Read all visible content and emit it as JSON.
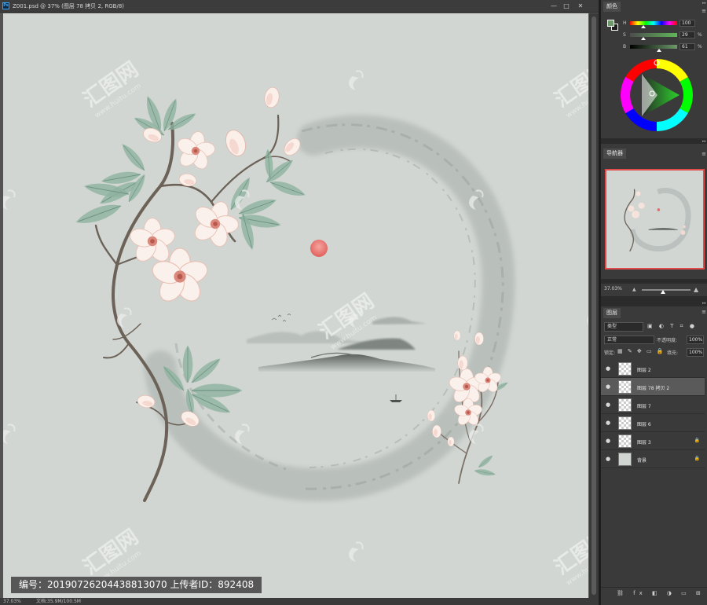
{
  "document": {
    "title": "Z001.psd @ 37% (图层 78 拷贝 2, RGB/8)",
    "zoom": "37.03%",
    "doc_size": "文档:35.9M/100.5M",
    "watermark_brand": "汇图网",
    "watermark_url": "www.huitu.com",
    "banner_text": "编号：20190726204438813070 上传者ID：892408"
  },
  "window_controls": {
    "minimize": "—",
    "restore": "□",
    "close": "✕"
  },
  "color_panel": {
    "tab": "颜色",
    "h_label": "H",
    "h_value": "100",
    "h_level": 0.28,
    "s_label": "S",
    "s_value": "29",
    "s_level": 0.29,
    "b_label": "B",
    "b_value": "61",
    "b_level": 0.61,
    "percent": "%",
    "foreground_color": "#6e9a6b",
    "background_color": "#1b1b1b"
  },
  "navigator_panel": {
    "tab": "导航器",
    "zoom_value": "37.03%",
    "frame_color": "#e34c4c"
  },
  "layers_panel": {
    "tab": "图层",
    "filter_kind": "类型",
    "blend_mode": "正常",
    "opacity_label": "不透明度:",
    "opacity_value": "100%",
    "lock_label": "锁定:",
    "fill_label": "填充:",
    "fill_value": "100%",
    "layers": [
      {
        "name": "图层 2",
        "thumb": "transparent",
        "locked": false,
        "selected": false
      },
      {
        "name": "图层 78 拷贝 2",
        "thumb": "transparent",
        "locked": false,
        "selected": true
      },
      {
        "name": "图层 7",
        "thumb": "transparent",
        "locked": false,
        "selected": false
      },
      {
        "name": "图层 6",
        "thumb": "transparent",
        "locked": false,
        "selected": false
      },
      {
        "name": "图层 3",
        "thumb": "transparent",
        "locked": true,
        "selected": false
      },
      {
        "name": "背景",
        "thumb": "solid",
        "locked": true,
        "selected": false
      }
    ]
  },
  "icons": {
    "ps_logo": "Ps",
    "eye": "●",
    "lock": "🔒",
    "menu": "≡",
    "collapse": "▸▸",
    "filter": "▣ ◐ T ⌗ ●",
    "locks": "▦ ✎ ✥ ▭ 🔒",
    "footer": "⛓ fx ◧ ◑ ▭ ⊞ 🗑",
    "mountain_small": "▲",
    "mountain_big": "▲"
  }
}
